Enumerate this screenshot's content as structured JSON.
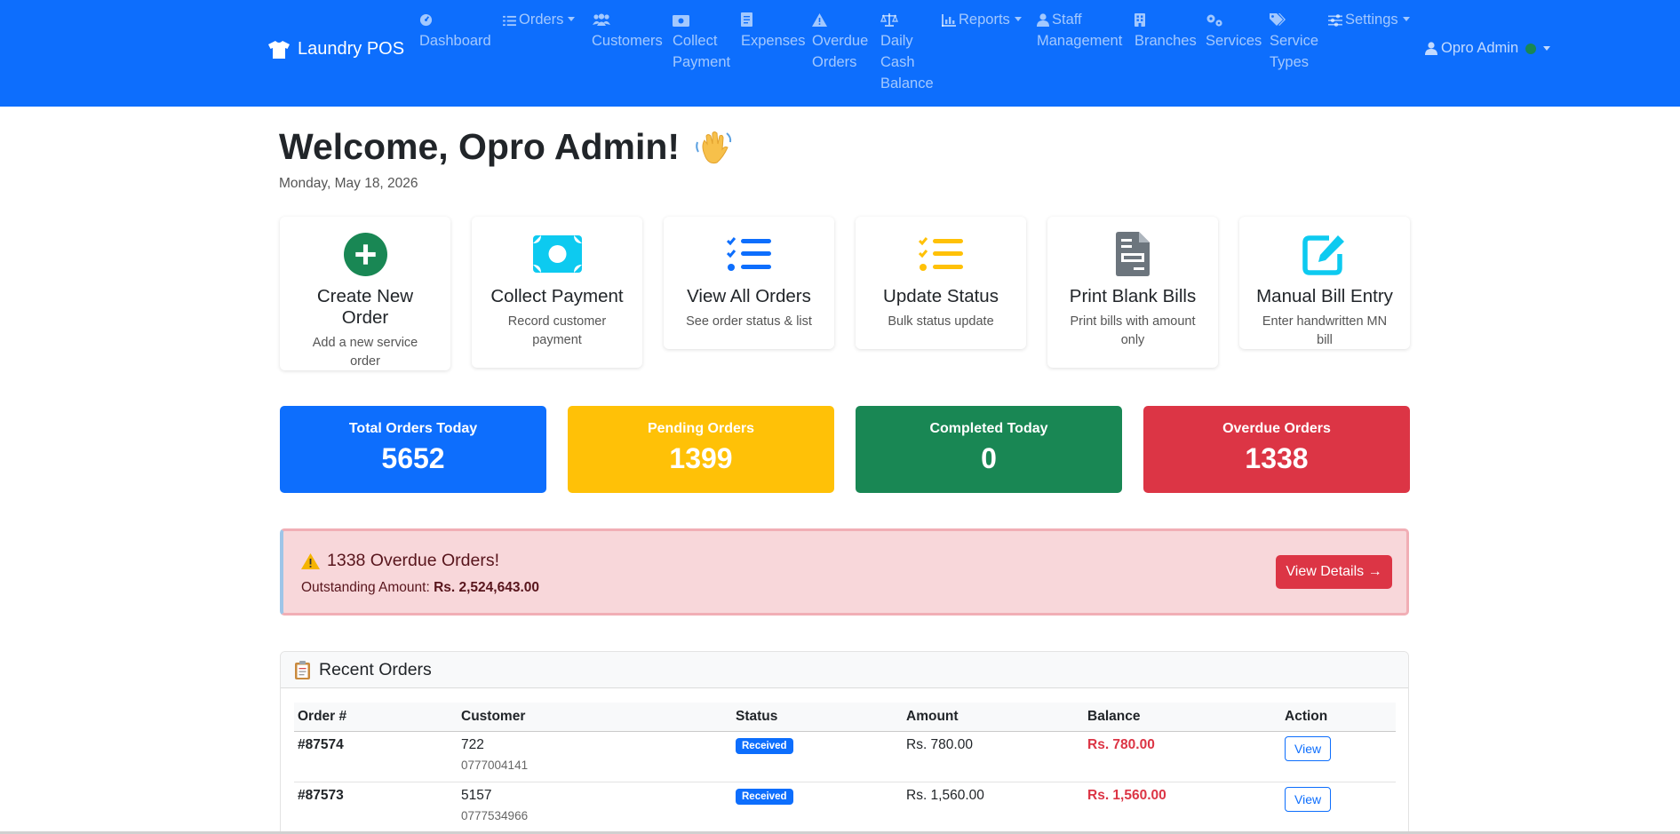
{
  "brand": {
    "name": "Laundry POS",
    "icon": "tshirt-icon"
  },
  "nav": {
    "dashboard": "Dashboard",
    "orders": "Orders",
    "customers": "Customers",
    "collect_payment": [
      "Collect",
      "Payment"
    ],
    "expenses": "Expenses",
    "overdue_orders": [
      "Overdue",
      "Orders"
    ],
    "daily_cash_balance": [
      "Daily",
      "Cash",
      "Balance"
    ],
    "reports": "Reports",
    "staff_management": [
      "Staff",
      "Management"
    ],
    "branches": "Branches",
    "services": "Services",
    "service_types": [
      "Service",
      "Types"
    ],
    "settings": "Settings",
    "user": "Opro Admin"
  },
  "welcome": {
    "title": "Welcome, Opro Admin!",
    "date": "Monday, May 18, 2026"
  },
  "actions": [
    {
      "title": "Create New Order",
      "desc": "Add a new service order",
      "icon": "plus-circle-icon",
      "color": "#198754"
    },
    {
      "title": "Collect Payment",
      "desc": "Record customer payment",
      "icon": "money-icon",
      "color": "#0dcaf0"
    },
    {
      "title": "View All Orders",
      "desc": "See order status & list",
      "icon": "list-check-icon",
      "color": "#0d6efd"
    },
    {
      "title": "Update Status",
      "desc": "Bulk status update",
      "icon": "list-check-icon",
      "color": "#ffc107"
    },
    {
      "title": "Print Blank Bills",
      "desc": "Print bills with amount only",
      "icon": "file-invoice-icon",
      "color": "#6c757d"
    },
    {
      "title": "Manual Bill Entry",
      "desc": "Enter handwritten MN bill",
      "icon": "edit-icon",
      "color": "#0dcaf0"
    }
  ],
  "stats": [
    {
      "label": "Total Orders Today",
      "value": "5652",
      "color": "#0d6efd"
    },
    {
      "label": "Pending Orders",
      "value": "1399",
      "color": "#ffc107"
    },
    {
      "label": "Completed Today",
      "value": "0",
      "color": "#198754"
    },
    {
      "label": "Overdue Orders",
      "value": "1338",
      "color": "#dc3545"
    }
  ],
  "alert": {
    "title": "1338 Overdue Orders!",
    "outstanding_label": "Outstanding Amount:",
    "outstanding_value": "Rs. 2,524,643.00",
    "button": "View Details →"
  },
  "recent": {
    "title": "Recent Orders",
    "columns": [
      "Order #",
      "Customer",
      "Status",
      "Amount",
      "Balance",
      "Action"
    ],
    "rows": [
      {
        "order": "#87574",
        "customer": "722",
        "phone": "0777004141",
        "status": "Received",
        "amount": "Rs. 780.00",
        "balance": "Rs. 780.00",
        "action": "View"
      },
      {
        "order": "#87573",
        "customer": "5157",
        "phone": "0777534966",
        "status": "Received",
        "amount": "Rs. 1,560.00",
        "balance": "Rs. 1,560.00",
        "action": "View"
      }
    ]
  }
}
